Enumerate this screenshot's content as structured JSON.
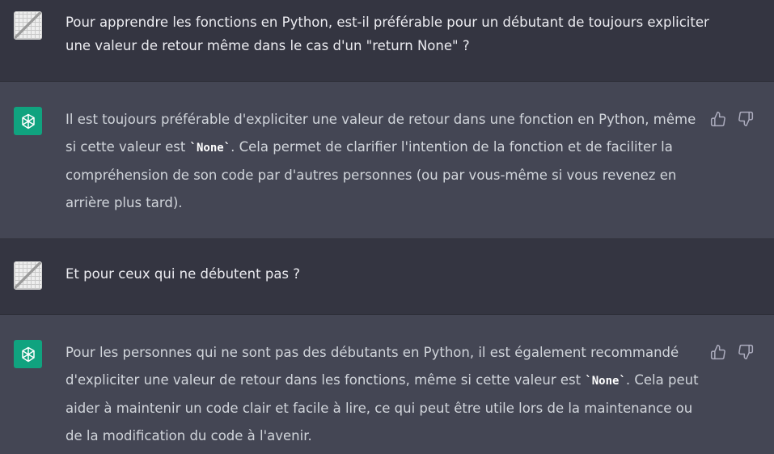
{
  "conversation": [
    {
      "role": "user",
      "text": "Pour apprendre les fonctions en Python, est-il préférable pour un débutant de toujours expliciter une valeur de retour même dans le cas d'un \"return None\" ?"
    },
    {
      "role": "assistant",
      "text_before_code": "Il est toujours préférable d'expliciter une valeur de retour dans une fonction en Python, même si cette valeur est ",
      "code": "`None`",
      "text_after_code": ". Cela permet de clarifier l'intention de la fonction et de faciliter la compréhension de son code par d'autres personnes (ou par vous-même si vous revenez en arrière plus tard)."
    },
    {
      "role": "user",
      "text": "Et pour ceux qui ne débutent pas ?"
    },
    {
      "role": "assistant",
      "text_before_code": "Pour les personnes qui ne sont pas des débutants en Python, il est également recommandé d'expliciter une valeur de retour dans les fonctions, même si cette valeur est ",
      "code": "`None`",
      "text_after_code": ". Cela peut aider à maintenir un code clair et facile à lire, ce qui peut être utile lors de la maintenance ou de la modification du code à l'avenir."
    }
  ],
  "icons": {
    "user_avatar": "user-avatar-icon",
    "assistant_avatar": "openai-logo-icon",
    "thumbs_up": "thumbs-up-icon",
    "thumbs_down": "thumbs-down-icon"
  },
  "colors": {
    "user_bg": "#343541",
    "assistant_bg": "#444654",
    "assistant_avatar_bg": "#10a37f"
  }
}
